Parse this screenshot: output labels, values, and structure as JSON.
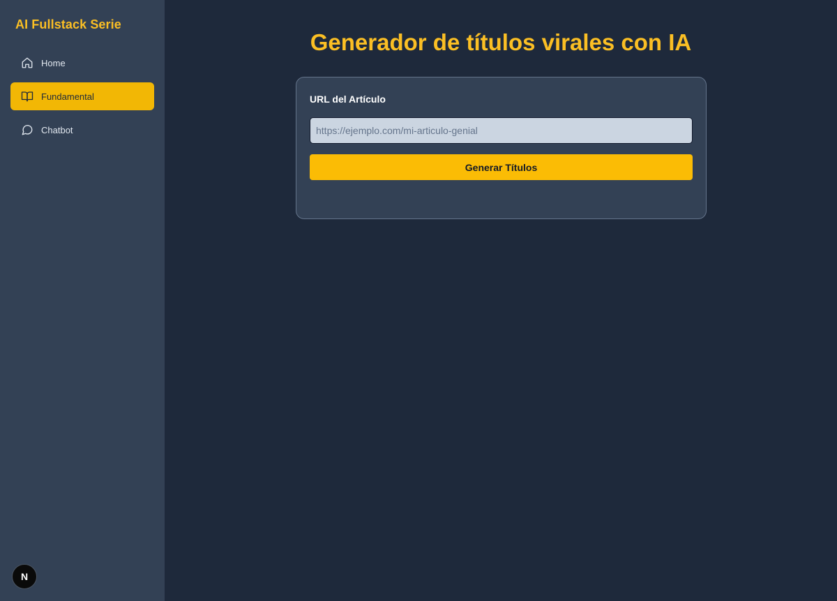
{
  "sidebar": {
    "brand": "AI Fullstack Serie",
    "items": [
      {
        "label": "Home",
        "icon": "home-icon",
        "active": false
      },
      {
        "label": "Fundamental",
        "icon": "book-open-icon",
        "active": true
      },
      {
        "label": "Chatbot",
        "icon": "message-circle-icon",
        "active": false
      }
    ],
    "badge": {
      "icon": "nextjs-logo-icon",
      "letter": "N"
    }
  },
  "main": {
    "title": "Generador de títulos virales con IA",
    "form": {
      "label": "URL del Artículo",
      "input_value": "",
      "input_placeholder": "https://ejemplo.com/mi-articulo-genial",
      "button_label": "Generar Títulos"
    }
  },
  "colors": {
    "accent": "#fbbf24",
    "sidebar_bg": "#334155",
    "main_bg": "#1e293b",
    "active_item_bg": "#f2b705",
    "button_bg": "#fbbc05"
  }
}
